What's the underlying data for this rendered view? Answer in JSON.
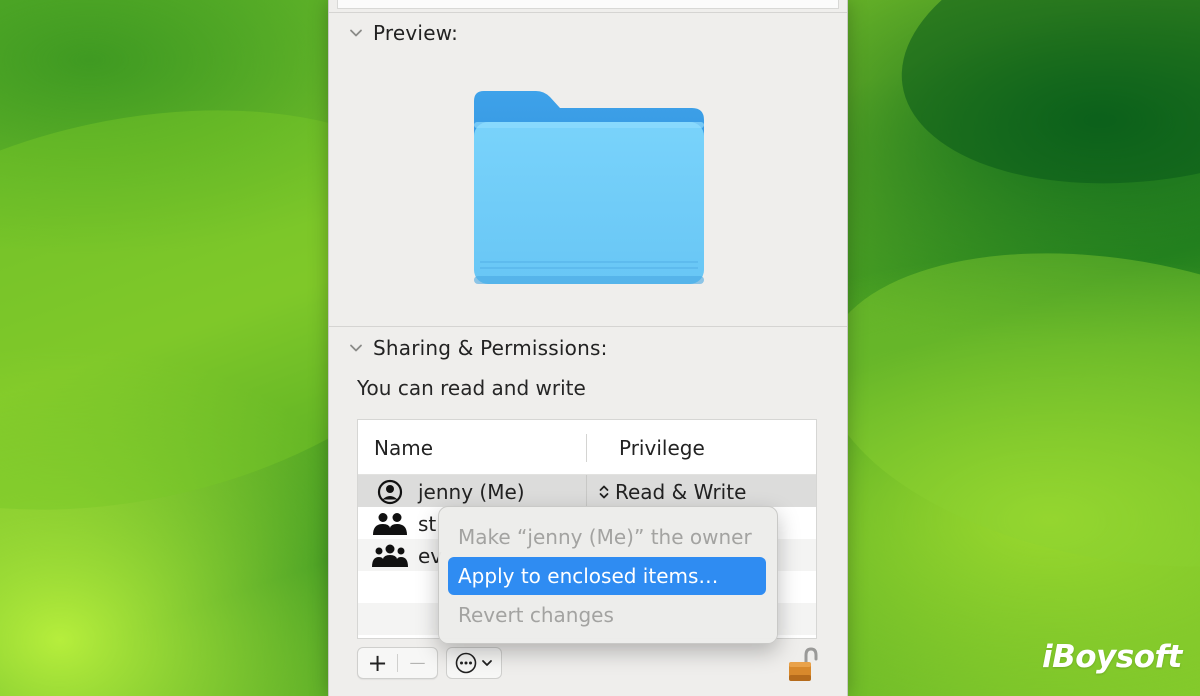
{
  "sections": {
    "preview": {
      "title": "Preview:"
    },
    "sharing": {
      "title": "Sharing & Permissions:"
    }
  },
  "permission_summary": "You can read and write",
  "table": {
    "columns": [
      "Name",
      "Privilege"
    ],
    "rows": [
      {
        "name": "jenny (Me)",
        "privilege": "Read & Write",
        "icon": "user-circle-icon"
      },
      {
        "name": "st",
        "privilege": "",
        "icon": "two-people-icon"
      },
      {
        "name": "ev",
        "privilege": "",
        "icon": "group-icon"
      }
    ]
  },
  "toolbar": {
    "add": "+",
    "remove": "—"
  },
  "context_menu": {
    "items": [
      {
        "label": "Make “jenny (Me)” the owner",
        "state": "disabled"
      },
      {
        "label": "Apply to enclosed items…",
        "state": "highlighted"
      },
      {
        "label": "Revert changes",
        "state": "disabled"
      }
    ]
  },
  "watermark": "iBoysoft",
  "colors": {
    "highlight": "#2f8cf2",
    "folder_light": "#72cdf8",
    "folder_dark": "#3a9be6"
  }
}
